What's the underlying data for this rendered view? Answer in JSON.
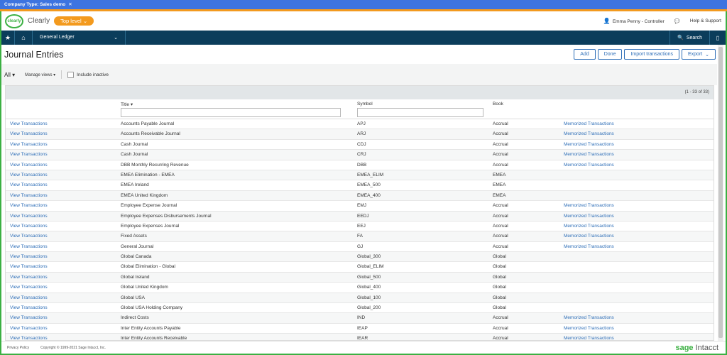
{
  "company_bar": {
    "label": "Company Type: Sales demo",
    "close": "✕"
  },
  "header": {
    "logo_text": "clearly",
    "company": "Clearly",
    "level": "Top level",
    "user": "Emma Penny - Controller",
    "help": "Help & Support"
  },
  "nav": {
    "module": "General Ledger",
    "search": "Search"
  },
  "page": {
    "title": "Journal Entries",
    "buttons": {
      "add": "Add",
      "done": "Done",
      "import": "Import transactions",
      "export": "Export"
    }
  },
  "filters": {
    "all": "All ▾",
    "manage_views": "Manage views ▾",
    "include_inactive": "Include inactive"
  },
  "table": {
    "count": "(1 - 33 of 33)",
    "columns": {
      "title": "Title",
      "symbol": "Symbol",
      "book": "Book"
    },
    "rows": [
      {
        "link": "View Transactions",
        "title": "Accounts Payable Journal",
        "symbol": "APJ",
        "book": "Accrual",
        "memo": "Memorized Transactions"
      },
      {
        "link": "View Transactions",
        "title": "Accounts Receivable Journal",
        "symbol": "ARJ",
        "book": "Accrual",
        "memo": "Memorized Transactions"
      },
      {
        "link": "View Transactions",
        "title": "Cash Journal",
        "symbol": "CDJ",
        "book": "Accrual",
        "memo": "Memorized Transactions"
      },
      {
        "link": "View Transactions",
        "title": "Cash Journal",
        "symbol": "CRJ",
        "book": "Accrual",
        "memo": "Memorized Transactions"
      },
      {
        "link": "View Transactions",
        "title": "DBB Monthly Recurring Revenue",
        "symbol": "DBB",
        "book": "Accrual",
        "memo": "Memorized Transactions"
      },
      {
        "link": "View Transactions",
        "title": "EMEA Elimination - EMEA",
        "symbol": "EMEA_ELIM",
        "book": "EMEA",
        "memo": ""
      },
      {
        "link": "View Transactions",
        "title": "EMEA Ireland",
        "symbol": "EMEA_500",
        "book": "EMEA",
        "memo": ""
      },
      {
        "link": "View Transactions",
        "title": "EMEA United Kingdom",
        "symbol": "EMEA_400",
        "book": "EMEA",
        "memo": ""
      },
      {
        "link": "View Transactions",
        "title": "Employee Expense Journal",
        "symbol": "EMJ",
        "book": "Accrual",
        "memo": "Memorized Transactions"
      },
      {
        "link": "View Transactions",
        "title": "Employee Expenses Disbursements Journal",
        "symbol": "EEDJ",
        "book": "Accrual",
        "memo": "Memorized Transactions"
      },
      {
        "link": "View Transactions",
        "title": "Employee Expenses Journal",
        "symbol": "EEJ",
        "book": "Accrual",
        "memo": "Memorized Transactions"
      },
      {
        "link": "View Transactions",
        "title": "Fixed Assets",
        "symbol": "FA",
        "book": "Accrual",
        "memo": "Memorized Transactions"
      },
      {
        "link": "View Transactions",
        "title": "General Journal",
        "symbol": "GJ",
        "book": "Accrual",
        "memo": "Memorized Transactions"
      },
      {
        "link": "View Transactions",
        "title": "Global Canada",
        "symbol": "Global_300",
        "book": "Global",
        "memo": ""
      },
      {
        "link": "View Transactions",
        "title": "Global Elimination - Global",
        "symbol": "Global_ELIM",
        "book": "Global",
        "memo": ""
      },
      {
        "link": "View Transactions",
        "title": "Global Ireland",
        "symbol": "Global_500",
        "book": "Global",
        "memo": ""
      },
      {
        "link": "View Transactions",
        "title": "Global United Kingdom",
        "symbol": "Global_400",
        "book": "Global",
        "memo": ""
      },
      {
        "link": "View Transactions",
        "title": "Global USA",
        "symbol": "Global_100",
        "book": "Global",
        "memo": ""
      },
      {
        "link": "View Transactions",
        "title": "Global USA Holding Company",
        "symbol": "Global_200",
        "book": "Global",
        "memo": ""
      },
      {
        "link": "View Transactions",
        "title": "Indirect Costs",
        "symbol": "IND",
        "book": "Accrual",
        "memo": "Memorized Transactions"
      },
      {
        "link": "View Transactions",
        "title": "Inter Entity Accounts Payable",
        "symbol": "IEAP",
        "book": "Accrual",
        "memo": "Memorized Transactions"
      },
      {
        "link": "View Transactions",
        "title": "Inter Entity Accounts Receivable",
        "symbol": "IEAR",
        "book": "Accrual",
        "memo": "Memorized Transactions"
      }
    ]
  },
  "footer": {
    "privacy": "Privacy Policy",
    "copyright": "Copyright © 1999-2021 Sage Intacct, Inc.",
    "brand_sage": "sage",
    "brand_intacct": "Intacct"
  }
}
